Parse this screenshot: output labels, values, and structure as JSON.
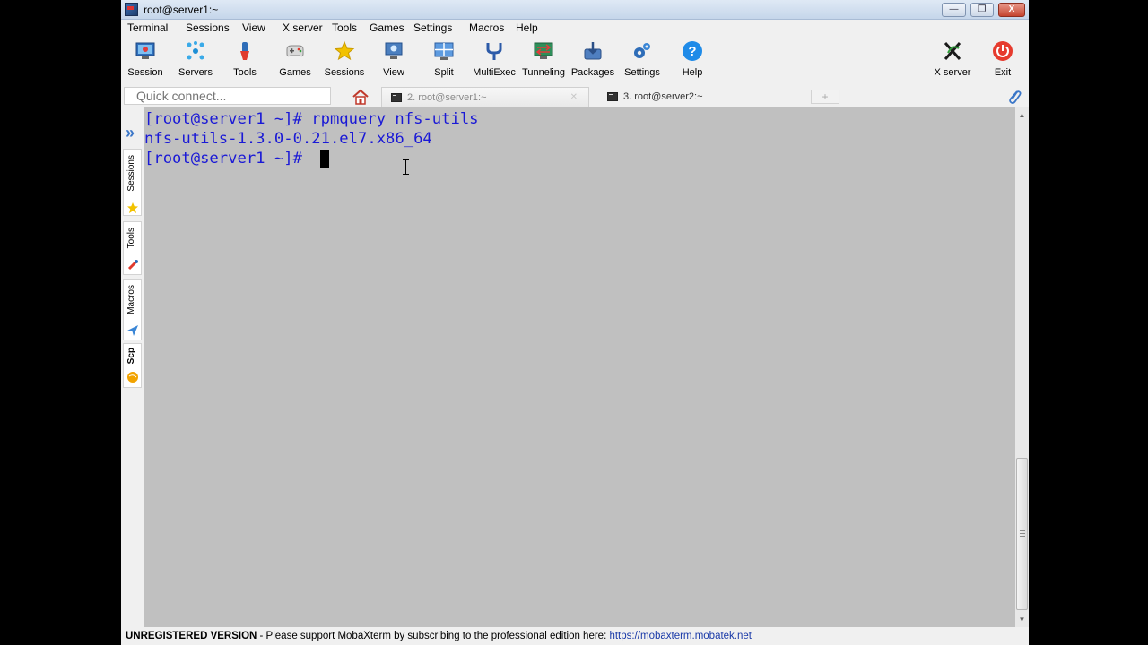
{
  "window": {
    "title": "root@server1:~",
    "minimize": "—",
    "maximize": "❐",
    "close": "X"
  },
  "menu": [
    "Terminal",
    "Sessions",
    "View",
    "X server",
    "Tools",
    "Games",
    "Settings",
    "Macros",
    "Help"
  ],
  "toolbar": {
    "session": "Session",
    "servers": "Servers",
    "tools": "Tools",
    "games": "Games",
    "sessions": "Sessions",
    "view": "View",
    "split": "Split",
    "multiexec": "MultiExec",
    "tunneling": "Tunneling",
    "packages": "Packages",
    "settings": "Settings",
    "help": "Help",
    "xserver": "X server",
    "exit": "Exit"
  },
  "quick_connect": {
    "placeholder": "Quick connect..."
  },
  "tabs": [
    {
      "label": "2. root@server1:~",
      "active": true
    },
    {
      "label": "3. root@server2:~",
      "active": false
    }
  ],
  "sidebar": {
    "sessions": "Sessions",
    "tools": "Tools",
    "macros": "Macros",
    "scp": "Scp"
  },
  "terminal": {
    "lines": [
      "[root@server1 ~]# rpmquery nfs-utils",
      "nfs-utils-1.3.0-0.21.el7.x86_64",
      "[root@server1 ~]# "
    ]
  },
  "status": {
    "bold": "UNREGISTERED VERSION",
    "message": " -  Please support MobaXterm by subscribing to the professional edition here:  ",
    "link": "https://mobaxterm.mobatek.net"
  },
  "colors": {
    "terminal_bg": "#c0c0c0",
    "terminal_fg": "#1a19d6",
    "accent": "#3a76c8"
  }
}
